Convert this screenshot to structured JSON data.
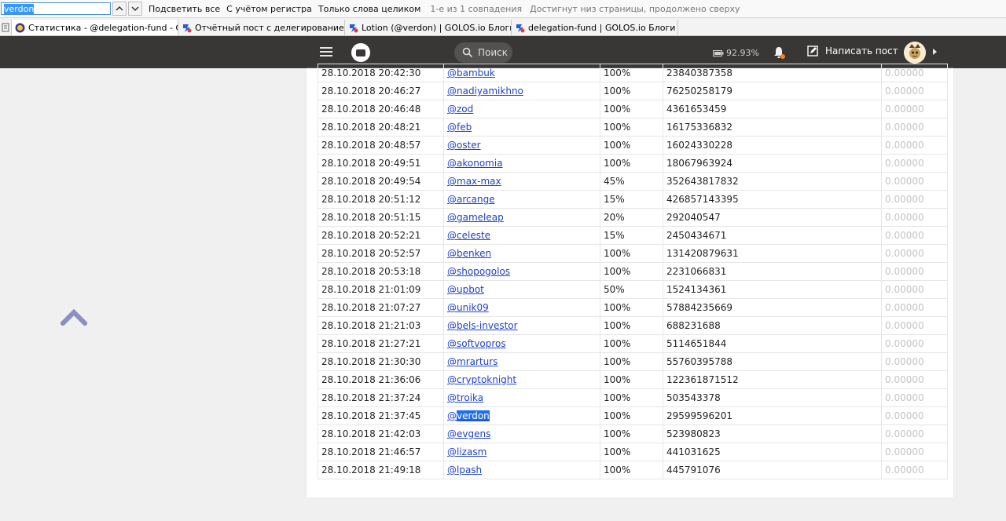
{
  "findbar": {
    "query": "verdon",
    "highlight_all": "Подсветить все",
    "match_case": "С учётом регистра",
    "whole_words": "Только слова целиком",
    "match_count": "1-е из 1 совпадения",
    "wrap_notice": "Достигнут низ страницы, продолжено сверху"
  },
  "tabs": [
    {
      "label": "Статистика - @delegation-fund - GoldV...",
      "active": true,
      "icon": "golos-favicon"
    },
    {
      "label": "Отчётный пост с делегированием сил...",
      "active": false,
      "icon": "golos-blog-favicon"
    },
    {
      "label": "Lotion (@verdon) | GOLOS.io Блоги",
      "active": false,
      "icon": "golos-blog-favicon"
    },
    {
      "label": "delegation-fund | GOLOS.io Блоги",
      "active": false,
      "icon": "golos-blog-favicon"
    }
  ],
  "header": {
    "search_placeholder": "Поиск",
    "battery": "92.93%",
    "write_post": "Написать пост"
  },
  "highlight_user": "verdon",
  "rows": [
    {
      "date": "28.10.2018 20:42:30",
      "user": "@bambuk",
      "percent": "100%",
      "rshares": "23840387358",
      "value": "0.00000"
    },
    {
      "date": "28.10.2018 20:46:27",
      "user": "@nadiyamikhno",
      "percent": "100%",
      "rshares": "76250258179",
      "value": "0.00000"
    },
    {
      "date": "28.10.2018 20:46:48",
      "user": "@zod",
      "percent": "100%",
      "rshares": "4361653459",
      "value": "0.00000"
    },
    {
      "date": "28.10.2018 20:48:21",
      "user": "@feb",
      "percent": "100%",
      "rshares": "16175336832",
      "value": "0.00000"
    },
    {
      "date": "28.10.2018 20:48:57",
      "user": "@oster",
      "percent": "100%",
      "rshares": "16024330228",
      "value": "0.00000"
    },
    {
      "date": "28.10.2018 20:49:51",
      "user": "@akonomia",
      "percent": "100%",
      "rshares": "18067963924",
      "value": "0.00000"
    },
    {
      "date": "28.10.2018 20:49:54",
      "user": "@max-max",
      "percent": "45%",
      "rshares": "352643817832",
      "value": "0.00000"
    },
    {
      "date": "28.10.2018 20:51:12",
      "user": "@arcange",
      "percent": "15%",
      "rshares": "426857143395",
      "value": "0.00000"
    },
    {
      "date": "28.10.2018 20:51:15",
      "user": "@gameleap",
      "percent": "20%",
      "rshares": "292040547",
      "value": "0.00000"
    },
    {
      "date": "28.10.2018 20:52:21",
      "user": "@celeste",
      "percent": "15%",
      "rshares": "2450434671",
      "value": "0.00000"
    },
    {
      "date": "28.10.2018 20:52:57",
      "user": "@benken",
      "percent": "100%",
      "rshares": "131420879631",
      "value": "0.00000"
    },
    {
      "date": "28.10.2018 20:53:18",
      "user": "@shopogolos",
      "percent": "100%",
      "rshares": "2231066831",
      "value": "0.00000"
    },
    {
      "date": "28.10.2018 21:01:09",
      "user": "@upbot",
      "percent": "50%",
      "rshares": "1524134361",
      "value": "0.00000"
    },
    {
      "date": "28.10.2018 21:07:27",
      "user": "@unik09",
      "percent": "100%",
      "rshares": "57884235669",
      "value": "0.00000"
    },
    {
      "date": "28.10.2018 21:21:03",
      "user": "@bels-investor",
      "percent": "100%",
      "rshares": "688231688",
      "value": "0.00000"
    },
    {
      "date": "28.10.2018 21:27:21",
      "user": "@softvopros",
      "percent": "100%",
      "rshares": "5114651844",
      "value": "0.00000"
    },
    {
      "date": "28.10.2018 21:30:30",
      "user": "@mrarturs",
      "percent": "100%",
      "rshares": "55760395788",
      "value": "0.00000"
    },
    {
      "date": "28.10.2018 21:36:06",
      "user": "@cryptoknight",
      "percent": "100%",
      "rshares": "122361871512",
      "value": "0.00000"
    },
    {
      "date": "28.10.2018 21:37:24",
      "user": "@troika",
      "percent": "100%",
      "rshares": "503543378",
      "value": "0.00000"
    },
    {
      "date": "28.10.2018 21:37:45",
      "user": "@verdon",
      "percent": "100%",
      "rshares": "29599596201",
      "value": "0.00000"
    },
    {
      "date": "28.10.2018 21:42:03",
      "user": "@evgens",
      "percent": "100%",
      "rshares": "523980823",
      "value": "0.00000"
    },
    {
      "date": "28.10.2018 21:46:57",
      "user": "@lizasm",
      "percent": "100%",
      "rshares": "441031625",
      "value": "0.00000"
    },
    {
      "date": "28.10.2018 21:49:18",
      "user": "@lpash",
      "percent": "100%",
      "rshares": "445791076",
      "value": "0.00000"
    }
  ]
}
